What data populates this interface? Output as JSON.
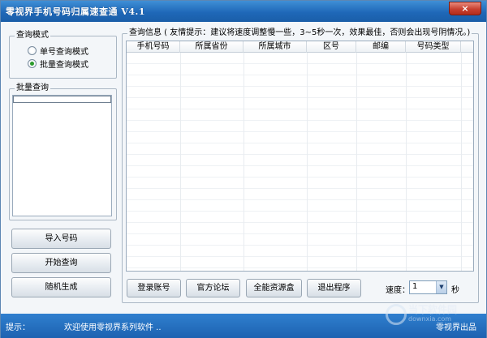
{
  "window": {
    "title": "零视界手机号码归属速查通 V4.1",
    "close_label": "×"
  },
  "mode": {
    "group_label": "查询模式",
    "options": [
      {
        "label": "单号查询模式",
        "checked": false
      },
      {
        "label": "批量查询模式",
        "checked": true
      }
    ]
  },
  "batch": {
    "group_label": "批量查询",
    "value": ""
  },
  "left_buttons": {
    "import": "导入号码",
    "start": "开始查询",
    "random": "随机生成"
  },
  "results": {
    "group_label": "查询信息 ( 友情提示：建议将速度调整慢一些，3~5秒一次，效果最佳，否则会出现号阴情况。)",
    "columns": [
      "手机号码",
      "所属省份",
      "所属城市",
      "区号",
      "邮编",
      "号码类型"
    ],
    "rows": []
  },
  "bottom_buttons": {
    "login": "登录账号",
    "forum": "官方论坛",
    "resources": "全能资源盒",
    "exit": "退出程序"
  },
  "speed": {
    "label": "速度：",
    "value": "1",
    "unit": "秒"
  },
  "status": {
    "hint_label": "提示：",
    "message": "欢迎使用零视界系列软件 ..",
    "brand": "零视界出品",
    "watermark_text": "当下软件园",
    "watermark_sub": "downxia.com"
  },
  "colors": {
    "titlebar": "#1f68b8",
    "statusbar": "#1d62b1",
    "radio_checked": "#2a9a2a",
    "close_button": "#c84030"
  }
}
